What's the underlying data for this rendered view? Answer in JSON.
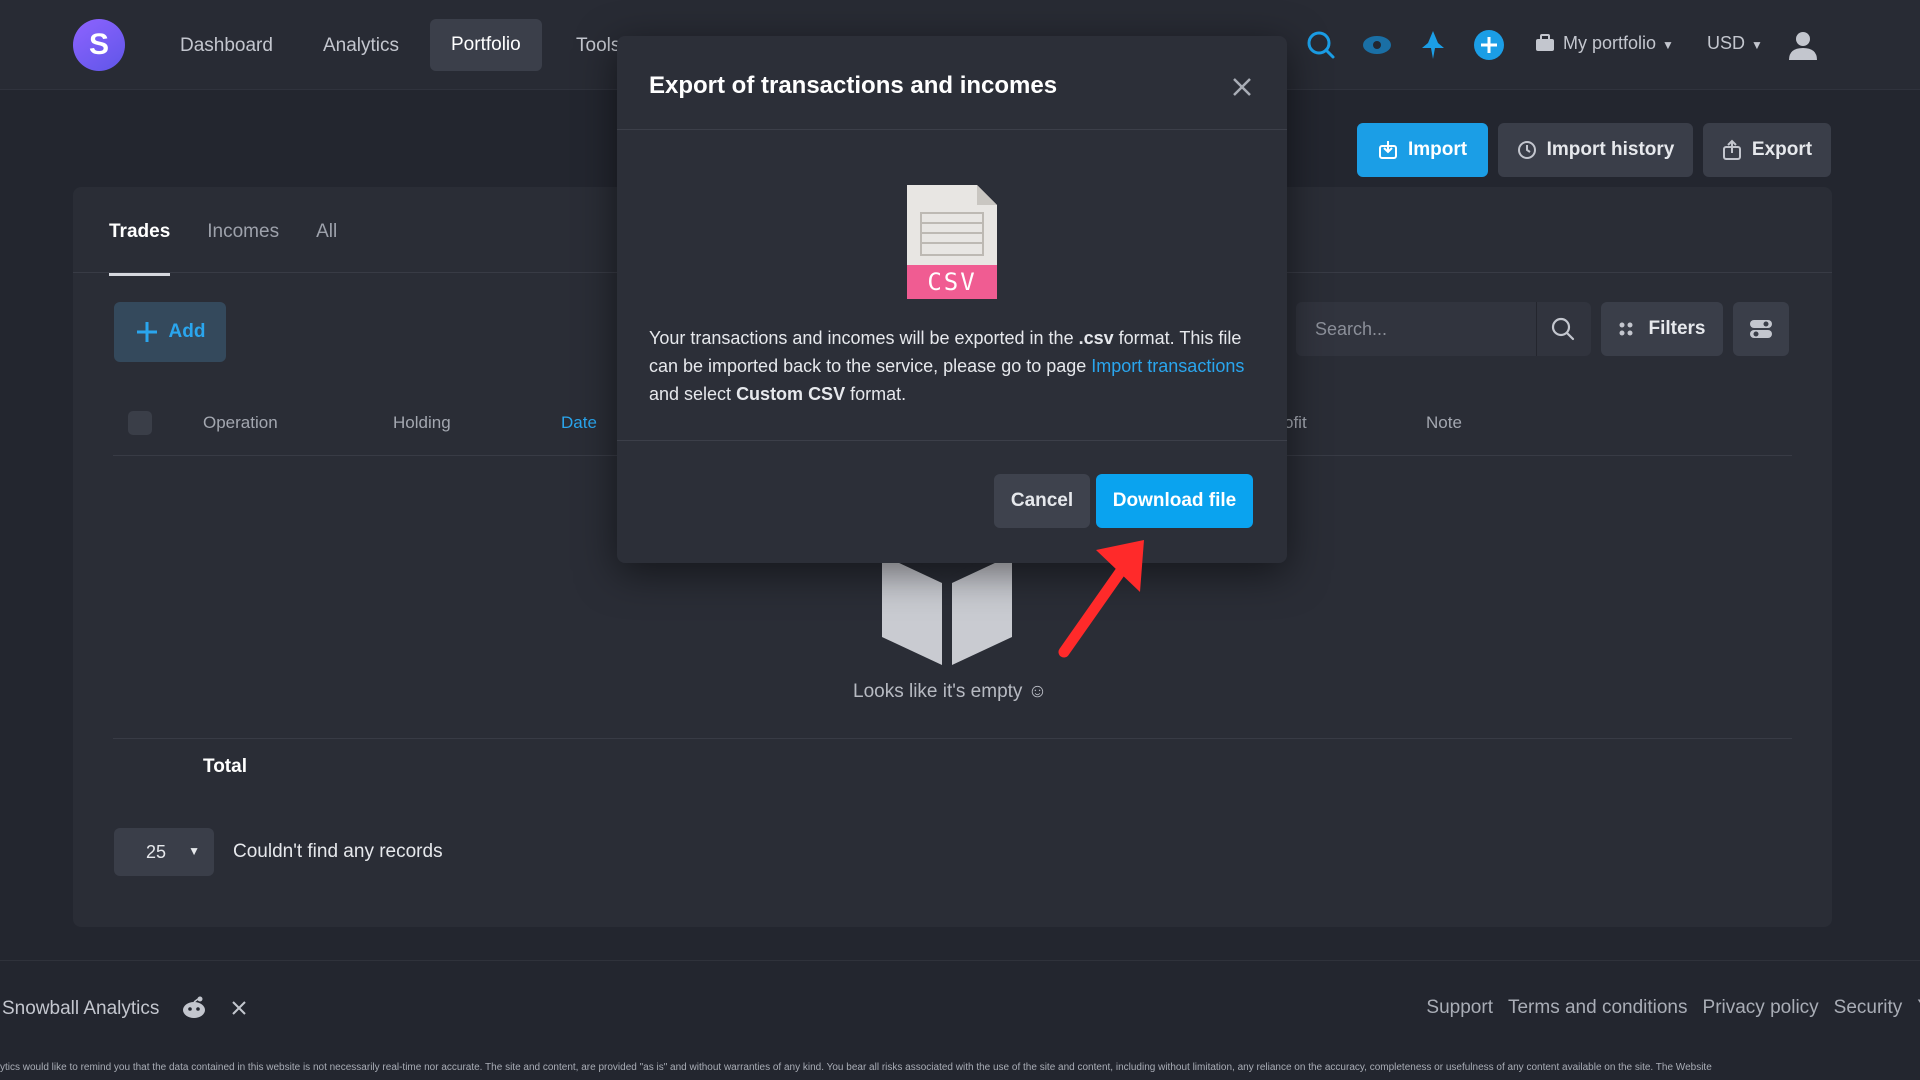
{
  "nav": {
    "logo_letter": "S",
    "items": [
      {
        "label": "Dashboard"
      },
      {
        "label": "Analytics"
      },
      {
        "label": "Portfolio"
      },
      {
        "label": "Tools"
      }
    ],
    "portfolio_label": "My portfolio",
    "currency_label": "USD"
  },
  "toolbar": {
    "import_label": "Import",
    "import_history_label": "Import history",
    "export_label": "Export"
  },
  "tabs": [
    {
      "label": "Trades"
    },
    {
      "label": "Incomes"
    },
    {
      "label": "All"
    }
  ],
  "actions": {
    "add_label": "Add",
    "search_placeholder": "Search...",
    "filters_label": "Filters"
  },
  "table": {
    "columns": [
      "Operation",
      "Holding",
      "Date",
      "ofit",
      "Note"
    ],
    "empty_text": "Looks like it's empty ☺",
    "total_label": "Total",
    "page_size": "25",
    "no_records_text": "Couldn't find any records"
  },
  "modal": {
    "title": "Export of transactions and incomes",
    "csv_label": "CSV",
    "body_1": "Your transactions and incomes will be exported in the ",
    "body_csv": ".csv",
    "body_2": " format. This file can be imported back to the service, please go to page ",
    "body_link": "Import transactions",
    "body_3": " and select ",
    "body_custom": "Custom CSV",
    "body_4": " format.",
    "cancel_label": "Cancel",
    "download_label": "Download file"
  },
  "footer": {
    "brand": "Snowball Analytics",
    "links": [
      "Support",
      "Terms and conditions",
      "Privacy policy",
      "Security",
      "Y"
    ],
    "disclaimer": "ytics would like to remind you that the data contained in this website is not necessarily real-time nor accurate. The site and content, are provided \"as is\" and without warranties of any kind. You bear all risks associated with the use of the site and content, including without limitation, any reliance on the accuracy, completeness or usefulness of any content available on the site. The Website"
  },
  "colors": {
    "accent_blue": "#1b9ee6",
    "background": "#23262f",
    "annotation_red": "#ff2a2a"
  }
}
